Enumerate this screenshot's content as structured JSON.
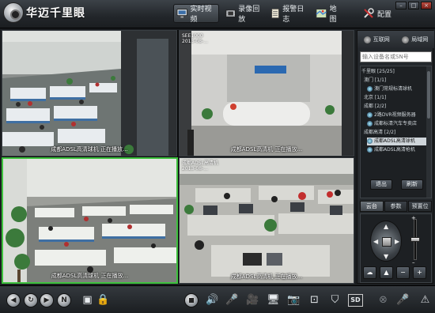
{
  "app": {
    "title": "华迈千里眼"
  },
  "nav": [
    {
      "id": "realtime",
      "label": "实时视频",
      "icon": "monitor-icon",
      "active": true
    },
    {
      "id": "playback",
      "label": "录像回放",
      "icon": "film-icon",
      "active": false
    },
    {
      "id": "alarm",
      "label": "报警日志",
      "icon": "notebook-icon",
      "active": false
    },
    {
      "id": "map",
      "label": "地图",
      "icon": "map-icon",
      "active": false
    },
    {
      "id": "config",
      "label": "配置",
      "icon": "tools-icon",
      "active": false
    }
  ],
  "cameras": [
    {
      "caption": "成都ADSL高清球机  正在播放...",
      "scene": "office-open",
      "selected": false
    },
    {
      "caption": "成都ADSL高清机  正在播放...",
      "scene": "reception",
      "osd": [
        "SEE1000",
        "2013-08-..."
      ],
      "selected": false
    },
    {
      "caption": "成都ADSL高清球机  正在播放...",
      "scene": "office-wide",
      "selected": true
    },
    {
      "caption": "成都ADSL高清机  正在播放...",
      "scene": "office-desks",
      "osd": [
        "成都ADSL高清机",
        "2013-08-..."
      ],
      "selected": false
    }
  ],
  "panel": {
    "tabs": [
      {
        "label": "互联网",
        "icon": "globe-icon"
      },
      {
        "label": "局域网",
        "icon": "lan-icon"
      }
    ],
    "search_placeholder": "输入设备名或SN号",
    "tree": [
      {
        "label": "千里眼 [25/25]",
        "level": 0,
        "icon": false
      },
      {
        "label": "澳门 [1/1]",
        "level": 1,
        "icon": false
      },
      {
        "label": "澳门常规标清球机",
        "level": 2,
        "icon": true
      },
      {
        "label": "北京 [1/1]",
        "level": 1,
        "icon": false
      },
      {
        "label": "成都 [2/2]",
        "level": 1,
        "icon": false
      },
      {
        "label": "2路DVR视频服务器",
        "level": 2,
        "icon": true
      },
      {
        "label": "成都标清汽车专卖店",
        "level": 2,
        "icon": true
      },
      {
        "label": "成都高清 [2/2]",
        "level": 1,
        "icon": false
      },
      {
        "label": "成都ADSL高清球机",
        "level": 2,
        "icon": true,
        "selected": true
      },
      {
        "label": "成都ADSL高清枪机",
        "level": 2,
        "icon": true
      }
    ],
    "exit_label": "退出",
    "refresh_label": "刷新",
    "ctrl_tabs": [
      {
        "label": "云台",
        "active": true
      },
      {
        "label": "参数",
        "active": false
      },
      {
        "label": "预置位",
        "active": false
      }
    ]
  },
  "accent_color": "#3ec13e"
}
